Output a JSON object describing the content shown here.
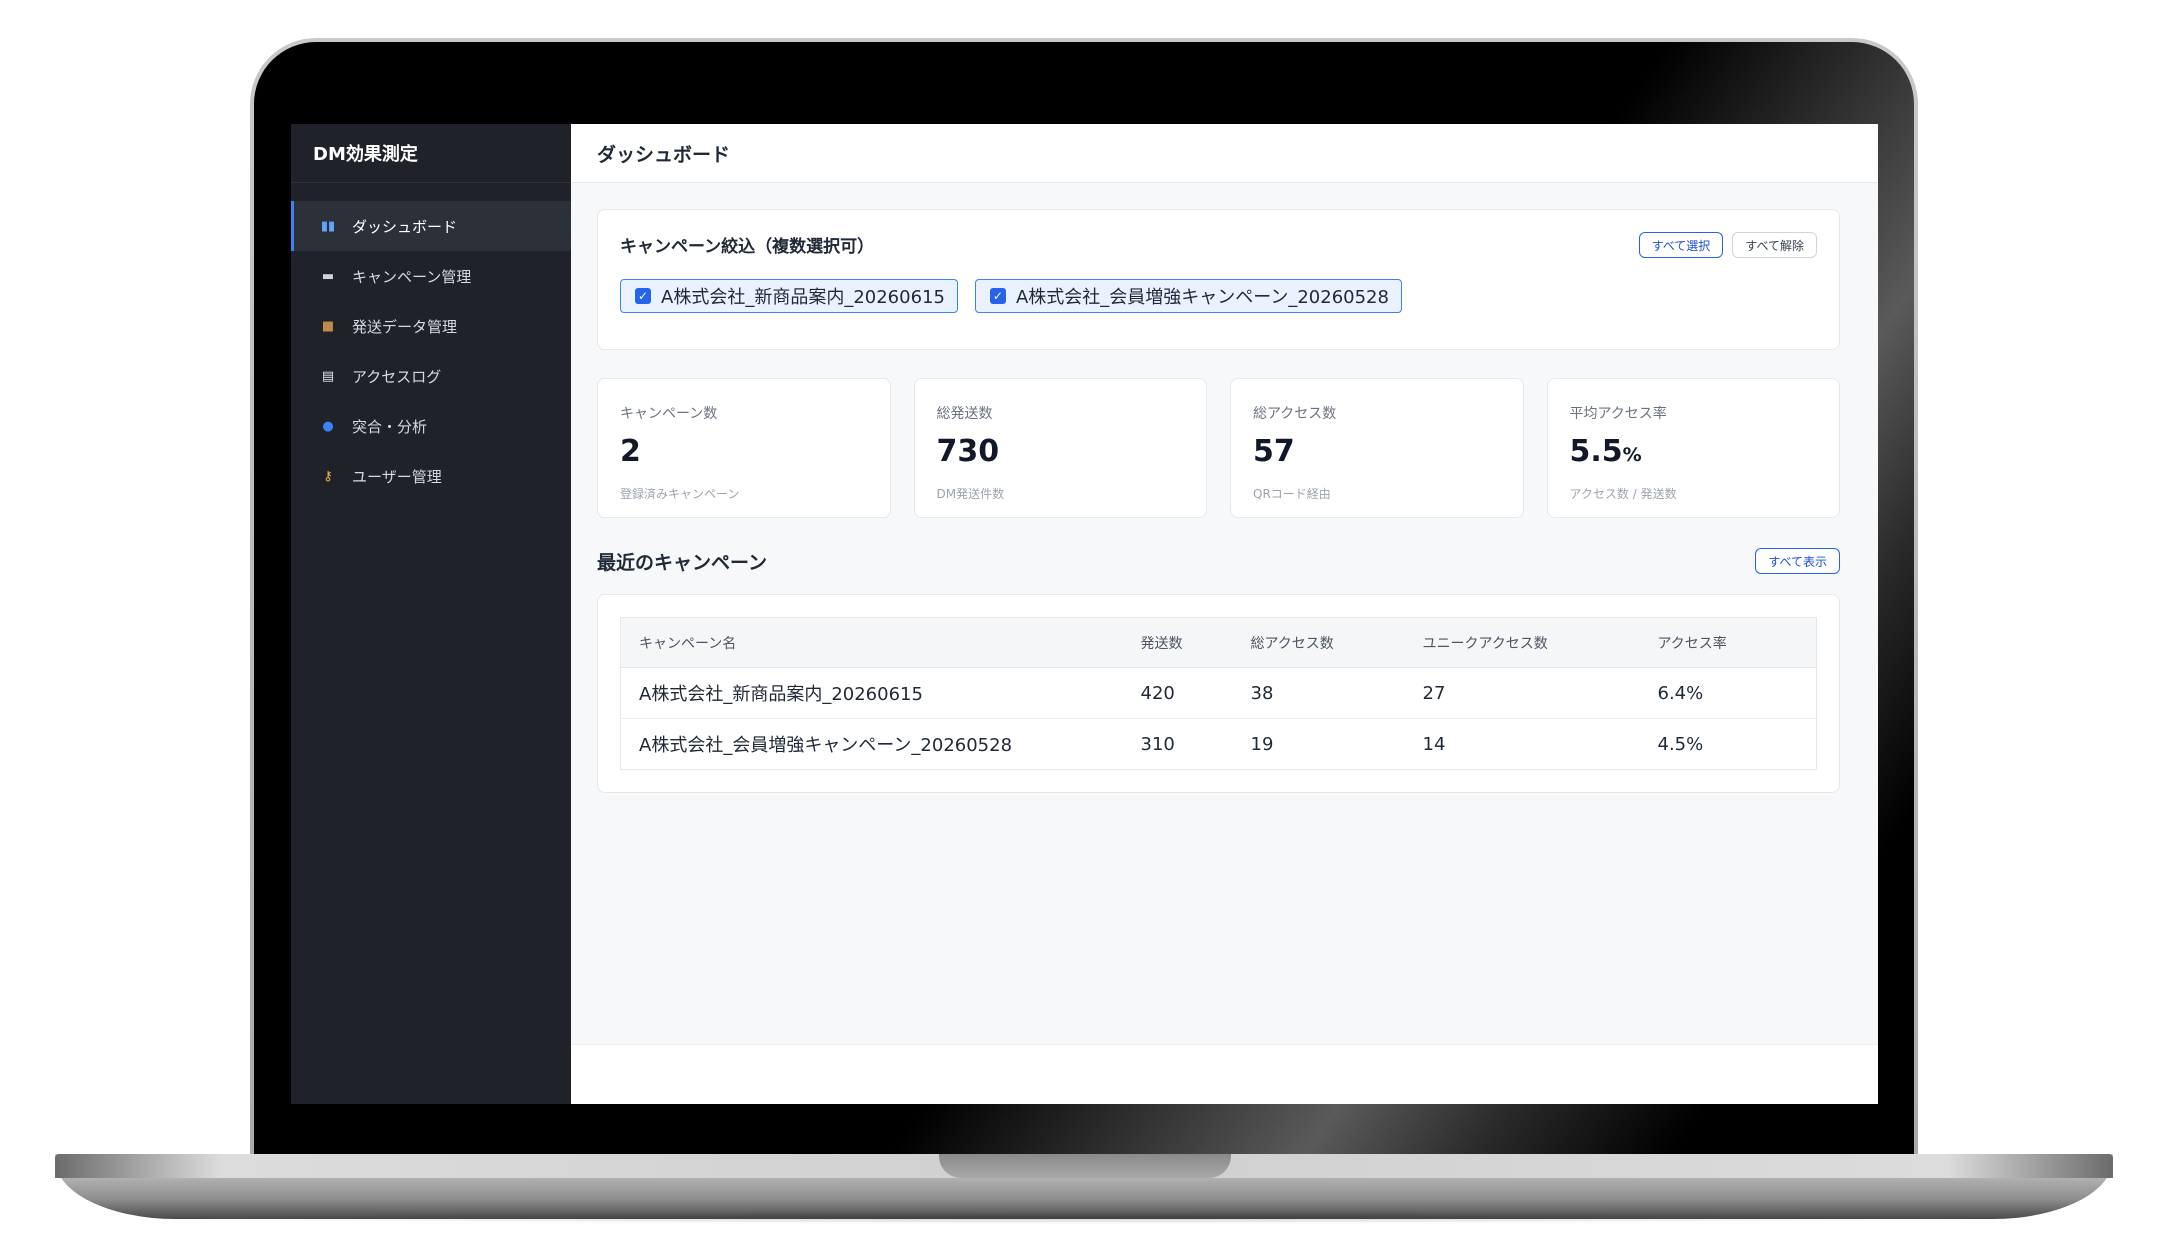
{
  "sidebar": {
    "brand": "DM効果測定",
    "items": [
      {
        "label": "ダッシュボード",
        "icon": "bar-chart-icon",
        "glyph": "▮▮",
        "icon_color": "#60a5fa",
        "active": true
      },
      {
        "label": "キャンペーン管理",
        "icon": "ticket-icon",
        "glyph": "▬",
        "icon_color": "#cbd5e1",
        "active": false
      },
      {
        "label": "発送データ管理",
        "icon": "package-icon",
        "glyph": "■",
        "icon_color": "#c08a4a",
        "active": false
      },
      {
        "label": "アクセスログ",
        "icon": "document-icon",
        "glyph": "▤",
        "icon_color": "#e5e7eb",
        "active": false
      },
      {
        "label": "突合・分析",
        "icon": "magnifier-icon",
        "glyph": "●",
        "icon_color": "#3b82f6",
        "active": false
      },
      {
        "label": "ユーザー管理",
        "icon": "key-icon",
        "glyph": "⚷",
        "icon_color": "#f5b942",
        "active": false
      }
    ]
  },
  "header": {
    "title": "ダッシュボード"
  },
  "filter": {
    "title": "キャンペーン絞込（複数選択可）",
    "select_all": "すべて選択",
    "clear_all": "すべて解除",
    "options": [
      {
        "label": "A株式会社_新商品案内_20260615",
        "checked": true
      },
      {
        "label": "A株式会社_会員増強キャンペーン_20260528",
        "checked": true
      }
    ]
  },
  "stats": [
    {
      "label": "キャンペーン数",
      "value": "2",
      "unit": "",
      "sub": "登録済みキャンペーン"
    },
    {
      "label": "総発送数",
      "value": "730",
      "unit": "",
      "sub": "DM発送件数"
    },
    {
      "label": "総アクセス数",
      "value": "57",
      "unit": "",
      "sub": "QRコード経由"
    },
    {
      "label": "平均アクセス率",
      "value": "5.5",
      "unit": "%",
      "sub": "アクセス数 / 発送数"
    }
  ],
  "recent": {
    "title": "最近のキャンペーン",
    "show_all": "すべて表示",
    "columns": [
      "キャンペーン名",
      "発送数",
      "総アクセス数",
      "ユニークアクセス数",
      "アクセス率"
    ],
    "rows": [
      [
        "A株式会社_新商品案内_20260615",
        "420",
        "38",
        "27",
        "6.4%"
      ],
      [
        "A株式会社_会員増強キャンペーン_20260528",
        "310",
        "19",
        "14",
        "4.5%"
      ]
    ]
  },
  "colors": {
    "accent": "#2563eb",
    "sidebar_bg": "#1f2329",
    "chip_bg": "#eaf2ff"
  }
}
